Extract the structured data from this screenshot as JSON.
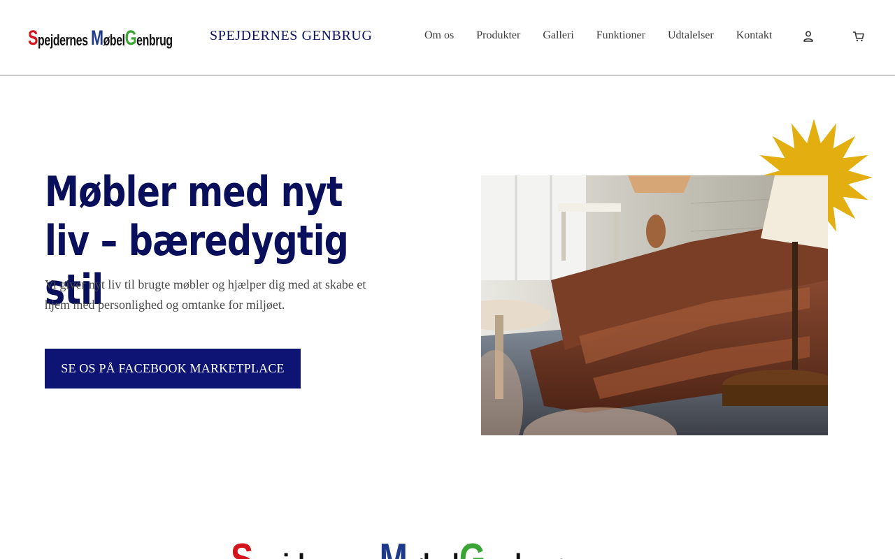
{
  "header": {
    "logo": {
      "word1_cap": "S",
      "word1_rest": "pejdernes",
      "word2_cap": "M",
      "word2_rest": "øbel",
      "word3_cap": "G",
      "word3_rest": "enbrug"
    },
    "brand_title": "SPEJDERNES GENBRUG",
    "nav": [
      "Om os",
      "Produkter",
      "Galleri",
      "Funktioner",
      "Udtalelser",
      "Kontakt"
    ],
    "account_icon": "user-icon",
    "cart_icon": "cart-icon"
  },
  "hero": {
    "title": "Møbler med nyt liv – bæredygtig stil",
    "text": "Vi giver nyt liv til brugte møbler og hjælper dig med at skabe et hjem med personlighed og omtanke for miljøet.",
    "cta_label": "SE OS PÅ FACEBOOK MARKETPLACE"
  },
  "colors": {
    "navy": "#0d1473",
    "title_navy": "#0a0f5c",
    "starburst": "#e3ae10",
    "logo_red": "#d4141c",
    "logo_blue": "#1e3a8a",
    "logo_green": "#3aa535"
  },
  "footer_logo": {
    "word1_cap": "S",
    "word1_rest": "pejdernes",
    "word2_cap": "M",
    "word2_rest": "øbel",
    "word3_cap": "G",
    "word3_rest": "enbrug"
  }
}
